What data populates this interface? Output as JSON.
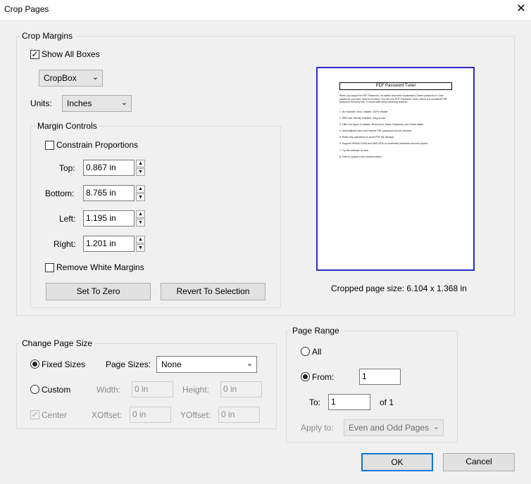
{
  "window": {
    "title": "Crop Pages",
    "close": "✕"
  },
  "crop_margins": {
    "legend": "Crop Margins",
    "show_all_boxes": {
      "label": "Show All Boxes",
      "checked": true
    },
    "box_select": "CropBox",
    "units_label": "Units:",
    "units_value": "Inches",
    "margin_controls": {
      "legend": "Margin Controls",
      "constrain_label": "Constrain Proportions",
      "top_label": "Top:",
      "top_value": "0.867 in",
      "bottom_label": "Bottom:",
      "bottom_value": "8.765 in",
      "left_label": "Left:",
      "left_value": "1.195 in",
      "right_label": "Right:",
      "right_value": "1.201 in",
      "remove_white_label": "Remove White Margins",
      "set_to_zero": "Set To Zero",
      "revert": "Revert To Selection"
    },
    "preview": {
      "doc_title": "PDF Password Tuner",
      "intro": "When you forgot the PDF Password, no matter what kind of password Owner password or User password, you don't need to be fixed. You can use PDF Password Tuner, which is a wonderful PDF password recovery tool. It comes with below amazing features:",
      "bullets": [
        "1. No malware, virus, adware, 100% reliable",
        "2. With user friendly interface, easy to use.",
        "3. Offer four types of attacks: Brute-force, Mask, Dictionary, and Smart attack.",
        "4. Automatically save and resume PDF password recover process.",
        "5. Read only operations to avoid PDF file damage.",
        "6. Support NVIDIA CUDA and AMD GPU to accelerate password recovery speed.",
        "7. Try the software for free.",
        "8. Free to update to the newest edition."
      ]
    },
    "cropped_size": "Cropped page size: 6.104 x 1.368 in"
  },
  "change_page_size": {
    "legend": "Change Page Size",
    "fixed_sizes": "Fixed Sizes",
    "page_sizes_label": "Page Sizes:",
    "page_sizes_value": "None",
    "custom": "Custom",
    "width_label": "Width:",
    "width_value": "0 in",
    "height_label": "Height:",
    "height_value": "0 in",
    "center": "Center",
    "xoffset_label": "XOffset:",
    "xoffset_value": "0 in",
    "yoffset_label": "YOffset:",
    "yoffset_value": "0 in"
  },
  "page_range": {
    "legend": "Page Range",
    "all": "All",
    "from": "From:",
    "from_value": "1",
    "to": "To:",
    "to_value": "1",
    "of": "of 1",
    "apply_to": "Apply to:",
    "apply_value": "Even and Odd Pages"
  },
  "buttons": {
    "ok": "OK",
    "cancel": "Cancel"
  }
}
